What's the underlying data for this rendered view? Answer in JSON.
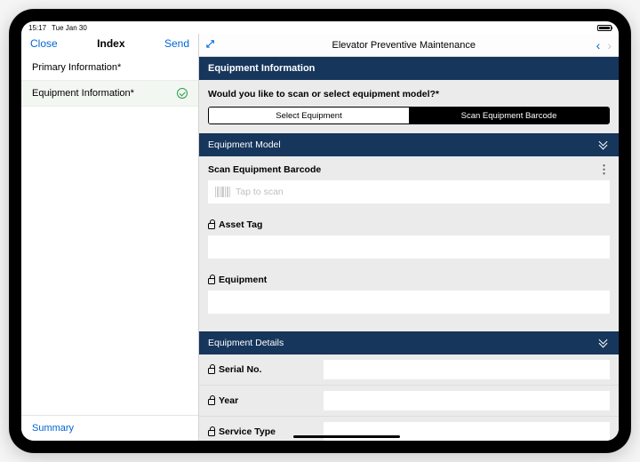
{
  "status": {
    "time": "15:17",
    "date": "Tue Jan 30"
  },
  "sidebar": {
    "close": "Close",
    "title": "Index",
    "send": "Send",
    "items": [
      {
        "label": "Primary Information*"
      },
      {
        "label": "Equipment Information*"
      }
    ],
    "summary": "Summary"
  },
  "main": {
    "title": "Elevator Preventive Maintenance",
    "section_title": "Equipment Information",
    "question": "Would you like to scan or select equipment model?*",
    "seg_select": "Select Equipment",
    "seg_scan": "Scan Equipment Barcode",
    "equipment_model": {
      "header": "Equipment Model",
      "scan_label": "Scan Equipment Barcode",
      "scan_placeholder": "Tap to scan",
      "asset_tag_label": "Asset Tag",
      "asset_tag_value": "",
      "equipment_label": "Equipment",
      "equipment_value": ""
    },
    "equipment_details": {
      "header": "Equipment Details",
      "serial_label": "Serial No.",
      "serial_value": "",
      "year_label": "Year",
      "year_value": "",
      "service_type_label": "Service Type",
      "service_type_value": ""
    }
  }
}
